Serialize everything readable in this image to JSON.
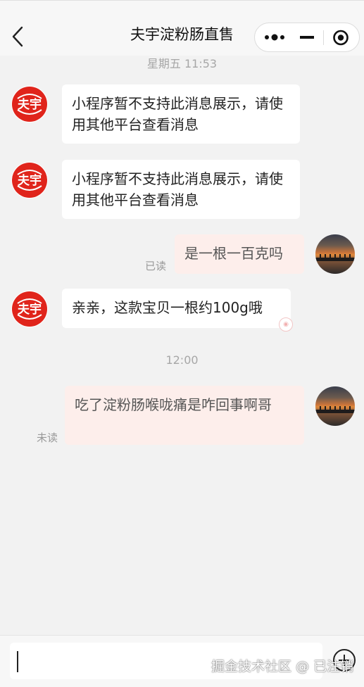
{
  "header": {
    "title": "夫宇淀粉肠直售",
    "icons": [
      "back-arrow-icon",
      "more-dots-icon",
      "minimize-icon",
      "close-record-icon"
    ]
  },
  "messages": {
    "time_1": "星期五 11:53",
    "m1_text": "小程序暂不支持此消息展示，请使用其他平台查看消息",
    "m2_text": "小程序暂不支持此消息展示，请使用其他平台查看消息",
    "m3_text": "是一根一百克吗",
    "m3_status": "已读",
    "m4_text": "亲亲，这款宝贝一根约100g哦",
    "time_2": "12:00",
    "m5_text": "吃了淀粉肠喉咙痛是咋回事啊哥",
    "m5_status": "未读"
  },
  "brand_logo": {
    "text": "夫宇",
    "color": "#e0241b"
  },
  "footer": {
    "input_value": "",
    "watermark": "掘金技术社区 @ 已注销"
  },
  "colors": {
    "incoming_bubble": "#ffffff",
    "outgoing_bubble": "#fdeeeb",
    "background": "#f2f2f2"
  }
}
